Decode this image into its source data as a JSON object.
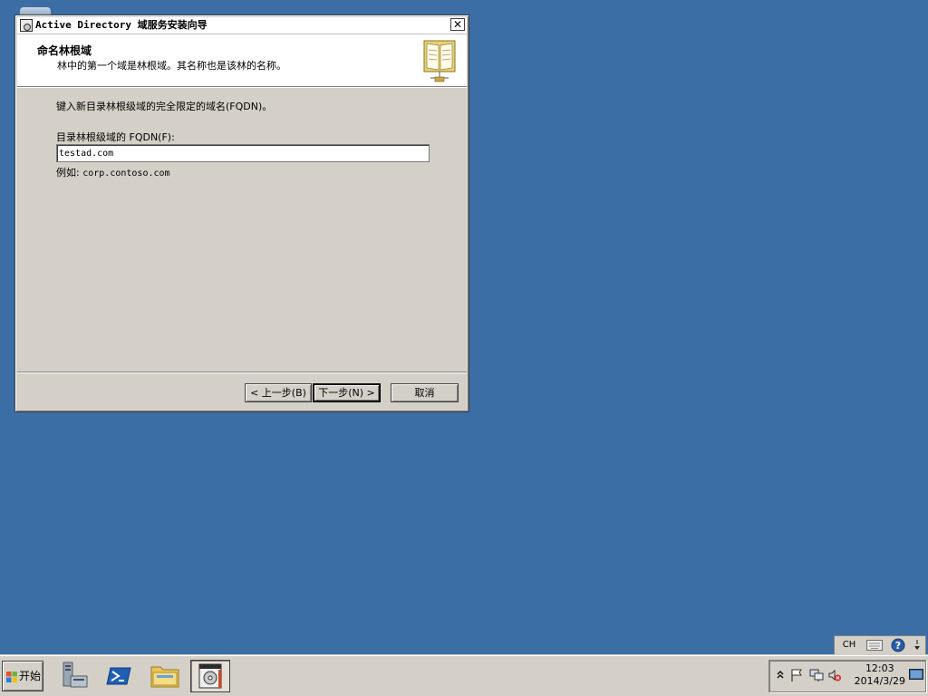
{
  "window": {
    "title": "Active Directory 域服务安装向导",
    "close_label": "✕"
  },
  "header": {
    "title": "命名林根域",
    "subtitle": "林中的第一个域是林根域。其名称也是该林的名称。"
  },
  "form": {
    "intro": "键入新目录林根级域的完全限定的域名(FQDN)。",
    "fqdn_label": "目录林根级域的 FQDN(F):",
    "fqdn_value": "testad.com",
    "example_label": "例如:",
    "example_value": "corp.contoso.com"
  },
  "buttons": {
    "back": "< 上一步(B)",
    "next": "下一步(N) >",
    "cancel": "取消"
  },
  "language_bar": {
    "lang": "CH",
    "keyboard_icon": "keyboard-icon",
    "help_icon": "help-icon",
    "options_icon": "chevron-down-icon"
  },
  "taskbar": {
    "start_label": "开始",
    "pinned": [
      "server-manager-icon",
      "powershell-icon",
      "explorer-folder-icon",
      "ad-wizard-icon"
    ]
  },
  "tray": {
    "time": "12:03",
    "date": "2014/3/29",
    "icons": [
      "show-hidden-icons-icon",
      "action-center-flag-icon",
      "network-icon",
      "volume-muted-icon",
      "show-desktop-icon"
    ]
  },
  "colors": {
    "desktop": "#3a6ea5",
    "window_face": "#d4d0c8",
    "header_bg": "#ffffff"
  }
}
